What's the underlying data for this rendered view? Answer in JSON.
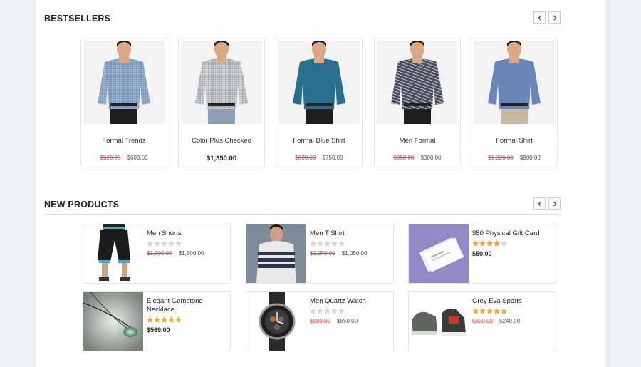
{
  "bestsellers": {
    "title": "BESTSELLERS",
    "products": [
      {
        "name": "Formal Trends",
        "old_price": "$520.00",
        "price": "$600.00",
        "shirt_color": "#9fb8d8"
      },
      {
        "name": "Color Plus Checked",
        "old_price": "",
        "price": "$1,350.00",
        "shirt_color": "#d8d8cf"
      },
      {
        "name": "Formal Blue Shirt",
        "old_price": "$820.00",
        "price": "$750.00",
        "shirt_color": "#2a6f8e"
      },
      {
        "name": "Men Formal",
        "old_price": "$350.00",
        "price": "$300.00",
        "shirt_color": "#4a4a5a"
      },
      {
        "name": "Formal Shirt",
        "old_price": "$1,020.00",
        "price": "$900.00",
        "shirt_color": "#6a86b9"
      }
    ]
  },
  "new_products": {
    "title": "NEW PRODUCTS",
    "products": [
      {
        "name": "Men Shorts",
        "rating": 0,
        "old_price": "$1,800.00",
        "price": "$1,500.00",
        "icon": "shorts-image"
      },
      {
        "name": "Men T Shirt",
        "rating": 0,
        "old_price": "$1,250.00",
        "price": "$1,050.00",
        "icon": "tshirt-image"
      },
      {
        "name": "$50 Physical Gift Card",
        "rating": 4,
        "old_price": "",
        "price": "$50.00",
        "icon": "gift-card-image"
      },
      {
        "name": "Elegant Gemstone Necklace",
        "rating": 5,
        "old_price": "",
        "price": "$569.00",
        "icon": "necklace-image"
      },
      {
        "name": "Men Quartz Watch",
        "rating": 0,
        "old_price": "$980.00",
        "price": "$850.00",
        "icon": "watch-image"
      },
      {
        "name": "Grey Eva Sports",
        "rating": 5,
        "old_price": "$320.00",
        "price": "$240.00",
        "icon": "sneakers-image"
      }
    ]
  },
  "colors": {
    "accent_star": "#f5a623",
    "empty_star": "#d9d9d9",
    "old_price": "#e04a4a"
  }
}
